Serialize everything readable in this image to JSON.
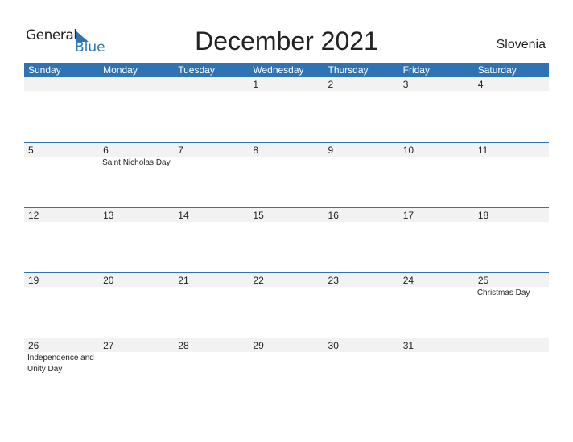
{
  "logo": {
    "general": "General",
    "blue": "Blue"
  },
  "title": "December 2021",
  "country": "Slovenia",
  "colors": {
    "accent": "#2e74b5",
    "band": "#f2f2f2"
  },
  "weekdays": [
    "Sunday",
    "Monday",
    "Tuesday",
    "Wednesday",
    "Thursday",
    "Friday",
    "Saturday"
  ],
  "weeks": [
    [
      {
        "d": ""
      },
      {
        "d": ""
      },
      {
        "d": ""
      },
      {
        "d": "1"
      },
      {
        "d": "2"
      },
      {
        "d": "3"
      },
      {
        "d": "4"
      }
    ],
    [
      {
        "d": "5"
      },
      {
        "d": "6",
        "h": "Saint Nicholas Day"
      },
      {
        "d": "7"
      },
      {
        "d": "8"
      },
      {
        "d": "9"
      },
      {
        "d": "10"
      },
      {
        "d": "11"
      }
    ],
    [
      {
        "d": "12"
      },
      {
        "d": "13"
      },
      {
        "d": "14"
      },
      {
        "d": "15"
      },
      {
        "d": "16"
      },
      {
        "d": "17"
      },
      {
        "d": "18"
      }
    ],
    [
      {
        "d": "19"
      },
      {
        "d": "20"
      },
      {
        "d": "21"
      },
      {
        "d": "22"
      },
      {
        "d": "23"
      },
      {
        "d": "24"
      },
      {
        "d": "25",
        "h": "Christmas Day"
      }
    ],
    [
      {
        "d": "26",
        "h": "Independence and Unity Day"
      },
      {
        "d": "27"
      },
      {
        "d": "28"
      },
      {
        "d": "29"
      },
      {
        "d": "30"
      },
      {
        "d": "31"
      },
      {
        "d": ""
      }
    ]
  ]
}
